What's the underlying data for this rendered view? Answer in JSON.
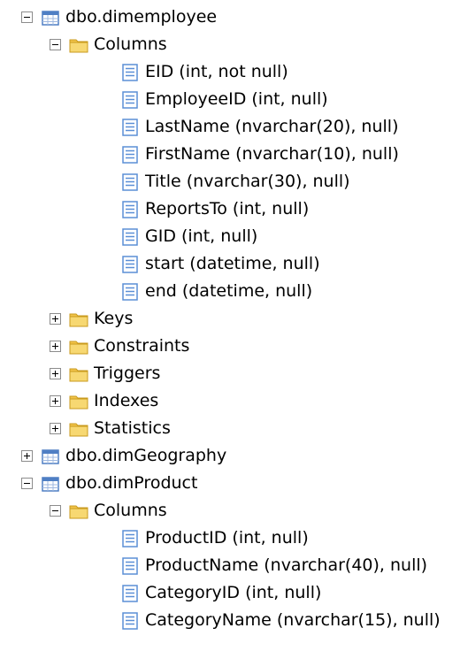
{
  "tree": {
    "tables": [
      {
        "name": "dbo.dimemployee",
        "expanded": true,
        "columns_folder": "Columns",
        "columns": [
          "EID (int, not null)",
          "EmployeeID (int, null)",
          "LastName (nvarchar(20), null)",
          "FirstName (nvarchar(10), null)",
          "Title (nvarchar(30), null)",
          "ReportsTo (int, null)",
          "GID (int, null)",
          "start (datetime, null)",
          "end (datetime, null)"
        ],
        "folders": [
          "Keys",
          "Constraints",
          "Triggers",
          "Indexes",
          "Statistics"
        ]
      },
      {
        "name": "dbo.dimGeography",
        "expanded": false
      },
      {
        "name": "dbo.dimProduct",
        "expanded": true,
        "columns_folder": "Columns",
        "columns": [
          "ProductID (int, null)",
          "ProductName (nvarchar(40), null)",
          "CategoryID (int, null)",
          "CategoryName (nvarchar(15), null)"
        ]
      }
    ]
  },
  "icons": {
    "table": "table-icon",
    "folder": "folder-icon",
    "column": "column-icon"
  },
  "colors": {
    "table_blue": "#4f7fc4",
    "folder_yellow": "#f2c44a",
    "column_blue": "#5b8fd6"
  }
}
